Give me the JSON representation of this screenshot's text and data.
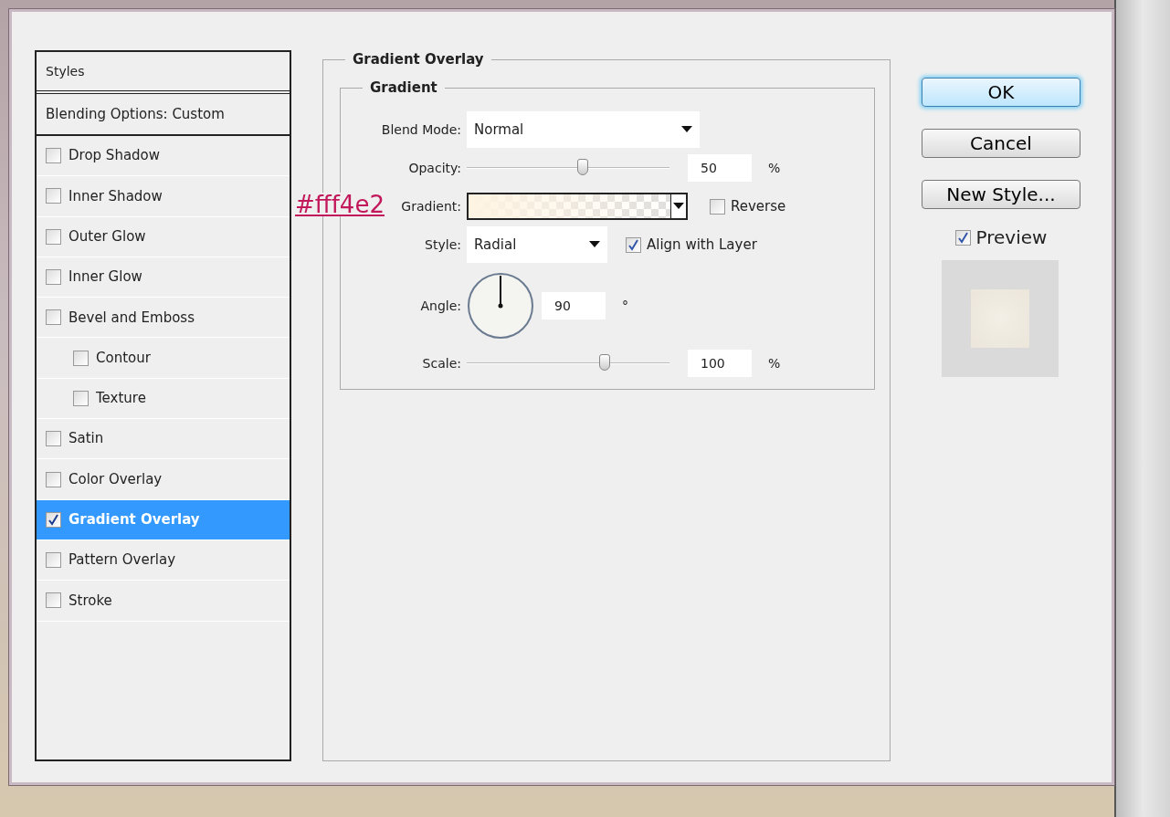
{
  "annotation": {
    "text": "#fff4e2"
  },
  "styles_list": {
    "header": "Styles",
    "blending_options": "Blending Options: Custom",
    "items": [
      {
        "label": "Drop Shadow",
        "checked": false,
        "selected": false
      },
      {
        "label": "Inner Shadow",
        "checked": false,
        "selected": false
      },
      {
        "label": "Outer Glow",
        "checked": false,
        "selected": false
      },
      {
        "label": "Inner Glow",
        "checked": false,
        "selected": false
      },
      {
        "label": "Bevel and Emboss",
        "checked": false,
        "selected": false,
        "children": [
          {
            "label": "Contour",
            "checked": false,
            "selected": false
          },
          {
            "label": "Texture",
            "checked": false,
            "selected": false
          }
        ]
      },
      {
        "label": "Satin",
        "checked": false,
        "selected": false
      },
      {
        "label": "Color Overlay",
        "checked": false,
        "selected": false
      },
      {
        "label": "Gradient Overlay",
        "checked": true,
        "selected": true
      },
      {
        "label": "Pattern Overlay",
        "checked": false,
        "selected": false
      },
      {
        "label": "Stroke",
        "checked": false,
        "selected": false
      }
    ]
  },
  "gradient_overlay": {
    "title": "Gradient Overlay",
    "group": "Gradient",
    "blend_mode": {
      "label": "Blend Mode:",
      "value": "Normal"
    },
    "opacity": {
      "label": "Opacity:",
      "level": 0.57,
      "value": "50",
      "unit": "%"
    },
    "gradient": {
      "label": "Gradient:"
    },
    "reverse": {
      "label": "Reverse",
      "checked": false
    },
    "style": {
      "label": "Style:",
      "value": "Radial"
    },
    "align_with_layer": {
      "label": "Align with Layer",
      "checked": true
    },
    "angle": {
      "label": "Angle:",
      "value": "90",
      "unit": "°"
    },
    "scale": {
      "label": "Scale:",
      "level": 0.68,
      "value": "100",
      "unit": "%"
    }
  },
  "buttons": [
    {
      "label": "OK",
      "default": true
    },
    {
      "label": "Cancel",
      "default": false
    },
    {
      "label": "New Style...",
      "default": false
    }
  ],
  "preview": {
    "label": "Preview",
    "checked": true
  }
}
